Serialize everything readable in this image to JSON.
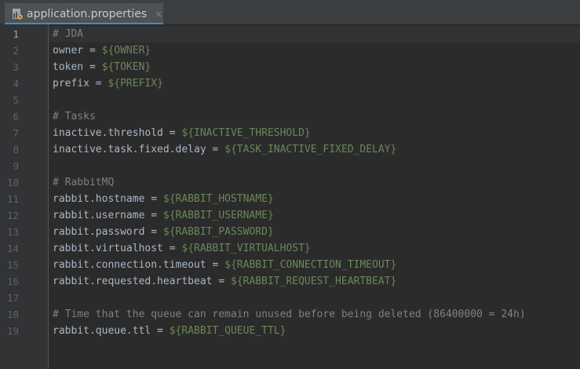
{
  "tab": {
    "title": "application.properties",
    "close": "×",
    "icon": "properties-file-icon"
  },
  "editor": {
    "current_line": 1,
    "lines": [
      {
        "n": "1",
        "type": "comment",
        "text": "# JDA"
      },
      {
        "n": "2",
        "type": "prop",
        "key": "owner = ",
        "value": "${OWNER}"
      },
      {
        "n": "3",
        "type": "prop",
        "key": "token = ",
        "value": "${TOKEN}"
      },
      {
        "n": "4",
        "type": "prop",
        "key": "prefix = ",
        "value": "${PREFIX}"
      },
      {
        "n": "5",
        "type": "blank",
        "text": ""
      },
      {
        "n": "6",
        "type": "comment",
        "text": "# Tasks"
      },
      {
        "n": "7",
        "type": "prop",
        "key": "inactive.threshold = ",
        "value": "${INACTIVE_THRESHOLD}"
      },
      {
        "n": "8",
        "type": "prop",
        "key": "inactive.task.fixed.delay = ",
        "value": "${TASK_INACTIVE_FIXED_DELAY}"
      },
      {
        "n": "9",
        "type": "blank",
        "text": ""
      },
      {
        "n": "10",
        "type": "comment",
        "text": "# RabbitMQ"
      },
      {
        "n": "11",
        "type": "prop",
        "key": "rabbit.hostname = ",
        "value": "${RABBIT_HOSTNAME}"
      },
      {
        "n": "12",
        "type": "prop",
        "key": "rabbit.username = ",
        "value": "${RABBIT_USERNAME}"
      },
      {
        "n": "13",
        "type": "prop",
        "key": "rabbit.password = ",
        "value": "${RABBIT_PASSWORD}"
      },
      {
        "n": "14",
        "type": "prop",
        "key": "rabbit.virtualhost = ",
        "value": "${RABBIT_VIRTUALHOST}"
      },
      {
        "n": "15",
        "type": "prop",
        "key": "rabbit.connection.timeout = ",
        "value": "${RABBIT_CONNECTION_TIMEOUT}"
      },
      {
        "n": "16",
        "type": "prop",
        "key": "rabbit.requested.heartbeat = ",
        "value": "${RABBIT_REQUEST_HEARTBEAT}"
      },
      {
        "n": "17",
        "type": "blank",
        "text": ""
      },
      {
        "n": "18",
        "type": "comment",
        "text": "# Time that the queue can remain unused before being deleted (86400000 = 24h)"
      },
      {
        "n": "19",
        "type": "prop",
        "key": "rabbit.queue.ttl = ",
        "value": "${RABBIT_QUEUE_TTL}"
      }
    ]
  },
  "colors": {
    "background": "#2b2b2b",
    "gutter": "#313335",
    "comment": "#808080",
    "key": "#a9b7c6",
    "value": "#6a8759",
    "tab_underline": "#4a88c7"
  }
}
